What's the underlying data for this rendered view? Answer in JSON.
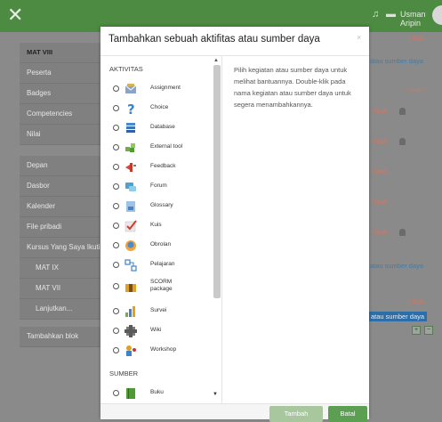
{
  "topbar": {
    "close_glyph": "✕",
    "bell_glyph": "♪",
    "chat_glyph": "▆",
    "user_name": "Usman Aripin"
  },
  "sidebar": {
    "block1": [
      "MAT VIII",
      "Peserta",
      "Badges",
      "Competencies",
      "Nilai"
    ],
    "block2": [
      "Depan",
      "Dasbor",
      "Kalender",
      "File pribadi",
      "Kursus Yang Saya Ikuti",
      "MAT IX",
      "MAT VII",
      "Lanjutkan..."
    ],
    "block3": [
      "Tambahkan blok"
    ]
  },
  "background_right": {
    "top_partial": "Ubah -",
    "link1": "atau sumber daya",
    "edit1": "Ubah -",
    "edit2": "Ubah -",
    "edit3": "Ubah -",
    "edit4": "Ubah -",
    "edit5": "Ubah -",
    "link2": "atau sumber daya",
    "edit6": "Ubah -",
    "link3": "atau sumber daya"
  },
  "modal": {
    "title": "Tambahkan sebuah aktifitas atau sumber daya",
    "close_glyph": "×",
    "category_activities": "AKTIVITAS",
    "category_resources": "SUMBER",
    "activities": [
      {
        "label": "Assignment",
        "icon": "assignment-icon"
      },
      {
        "label": "Choice",
        "icon": "choice-icon"
      },
      {
        "label": "Database",
        "icon": "database-icon"
      },
      {
        "label": "External tool",
        "icon": "external-tool-icon"
      },
      {
        "label": "Feedback",
        "icon": "feedback-icon"
      },
      {
        "label": "Forum",
        "icon": "forum-icon"
      },
      {
        "label": "Glossary",
        "icon": "glossary-icon"
      },
      {
        "label": "Kuis",
        "icon": "quiz-icon"
      },
      {
        "label": "Obrolan",
        "icon": "chat-icon"
      },
      {
        "label": "Pelajaran",
        "icon": "lesson-icon"
      },
      {
        "label": "SCORM package",
        "icon": "scorm-icon"
      },
      {
        "label": "Survei",
        "icon": "survey-icon"
      },
      {
        "label": "Wiki",
        "icon": "wiki-icon"
      },
      {
        "label": "Workshop",
        "icon": "workshop-icon"
      }
    ],
    "resources": [
      {
        "label": "Buku",
        "icon": "book-icon"
      }
    ],
    "description": "Pilih kegiatan atau sumber daya untuk melihat bantuannya. Double-klik pada nama kegiatan atau sumber daya untuk segera menambahkannya.",
    "add_button": "Tambah",
    "cancel_button": "Batal"
  },
  "colors": {
    "brand_green": "#5c9e52",
    "topbar_green": "#4d8a42",
    "overlay": "#8a8a8a"
  }
}
